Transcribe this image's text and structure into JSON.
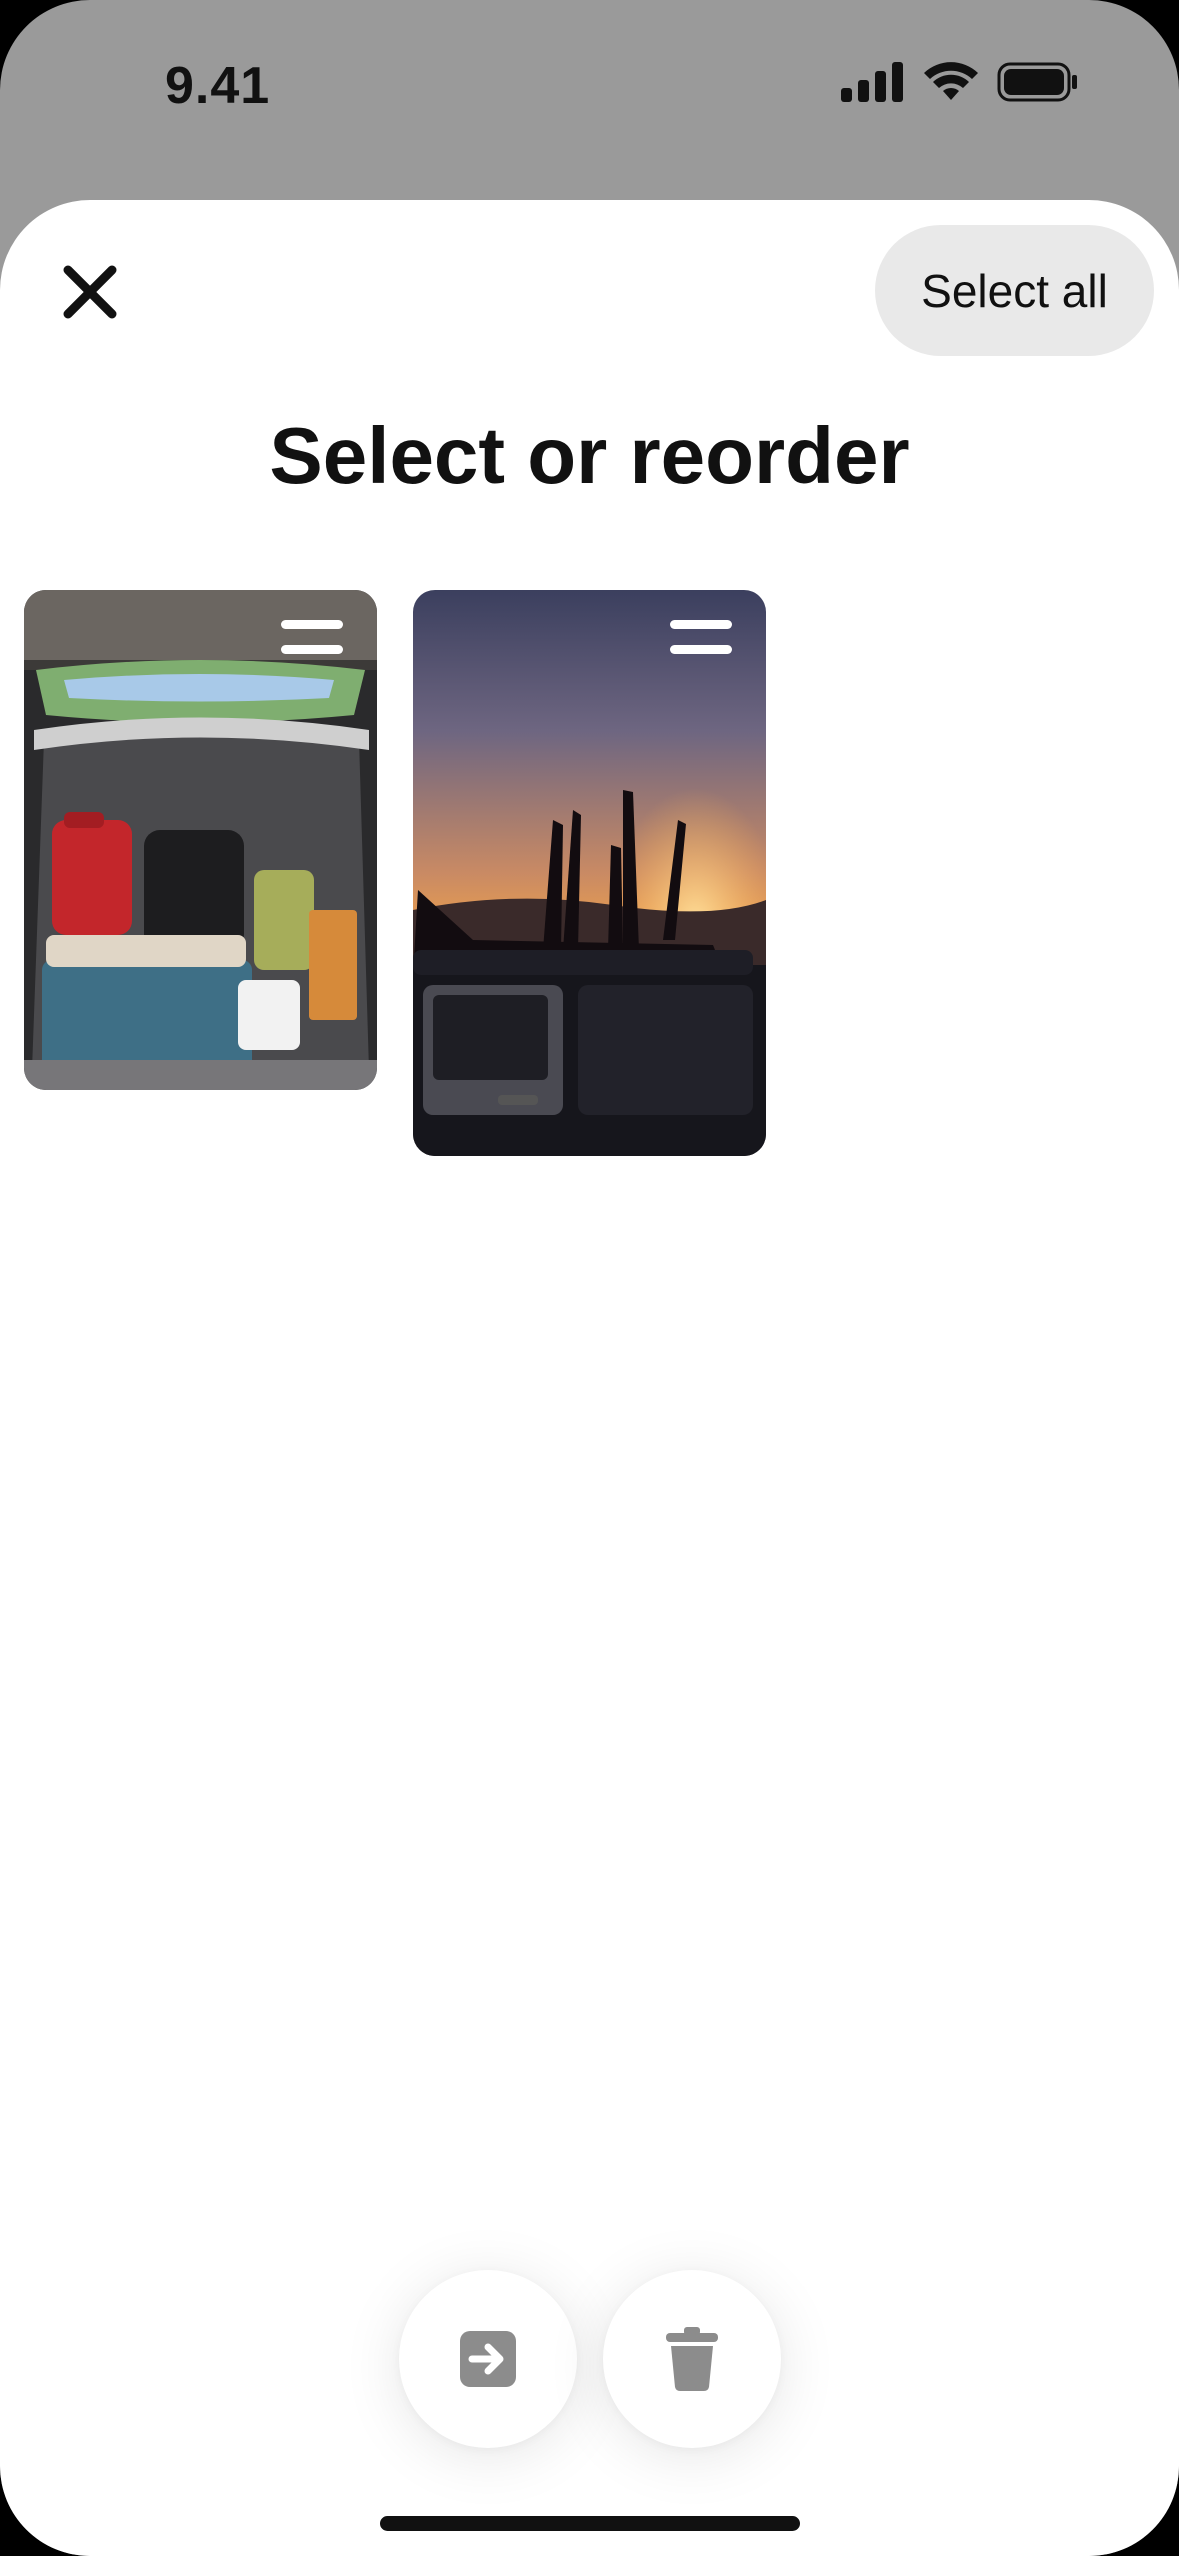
{
  "status_bar": {
    "time": "9.41",
    "icons": [
      "cellular-signal-icon",
      "wifi-icon",
      "battery-icon"
    ]
  },
  "header": {
    "close_icon": "close-icon",
    "select_all_label": "Select all",
    "title": "Select or reorder"
  },
  "items": [
    {
      "description_icon": "drag-handle-icon"
    },
    {
      "description_icon": "drag-handle-icon"
    }
  ],
  "actions": {
    "move_icon": "move-to-icon",
    "delete_icon": "trash-icon"
  },
  "colors": {
    "status_bar_bg": "#9a9a9a",
    "sheet_bg": "#ffffff",
    "pill_bg": "#e9e9e9",
    "action_icon": "#8c8c8c"
  }
}
